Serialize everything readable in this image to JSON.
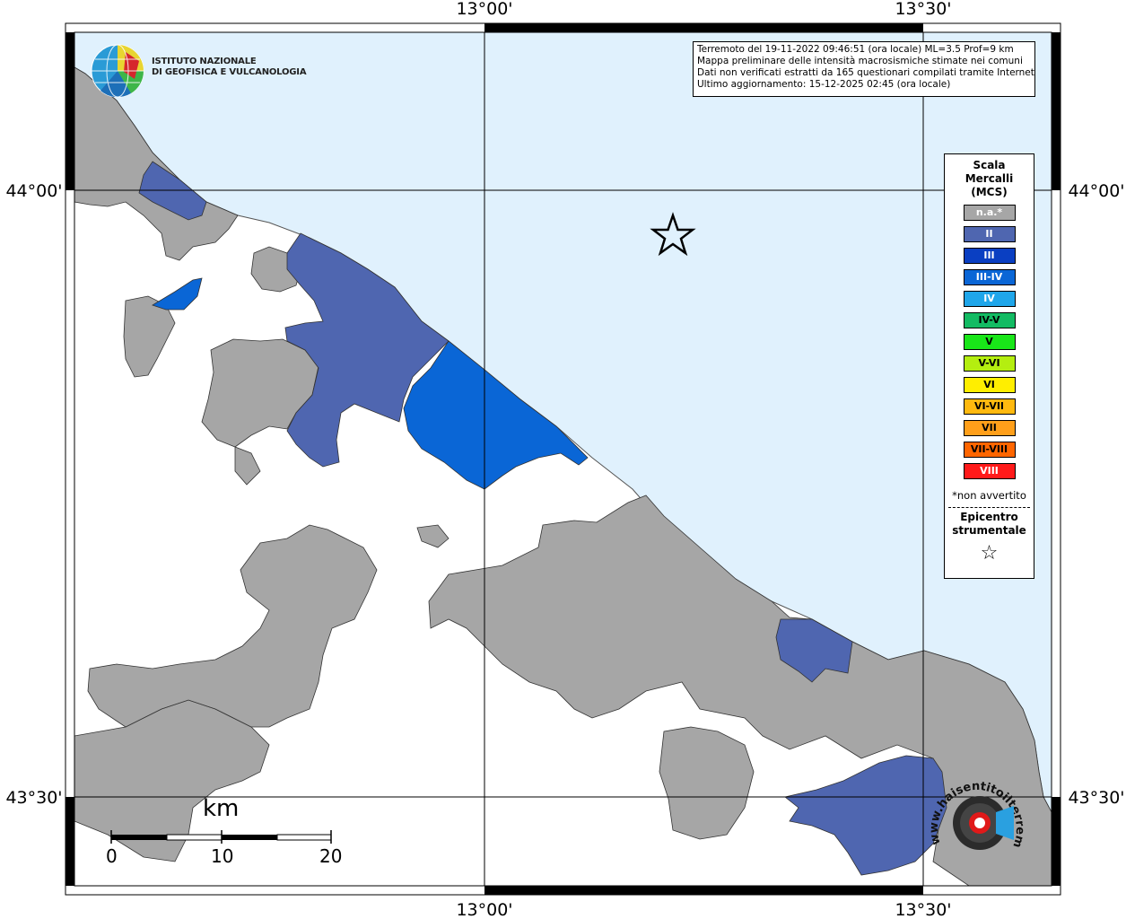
{
  "info": {
    "line1": "Terremoto del 19-11-2022 09:46:51 (ora locale) ML=3.5 Prof=9 km",
    "line2": "Mappa preliminare delle intensità macrosismiche stimate nei comuni",
    "line3": "Dati non verificati estratti da 165 questionari compilati tramite Internet.",
    "line4": "Ultimo aggiornamento: 15-12-2025 02:45 (ora locale)"
  },
  "institute": {
    "line1": "ISTITUTO NAZIONALE",
    "line2": "DI GEOFISICA E VULCANOLOGIA"
  },
  "axes": {
    "lon_top_1": "13°00'",
    "lon_top_2": "13°30'",
    "lon_bottom_1": "13°00'",
    "lon_bottom_2": "13°30'",
    "lat_left_1": "44°00'",
    "lat_left_2": "43°30'",
    "lat_right_1": "44°00'",
    "lat_right_2": "43°30'"
  },
  "legend": {
    "title_1": "Scala",
    "title_2": "Mercalli",
    "title_3": "(MCS)",
    "classes": [
      {
        "label": "n.a.*",
        "color": "#a6a6a6"
      },
      {
        "label": "II",
        "color": "#4f66b0"
      },
      {
        "label": "III",
        "color": "#0a3fc2"
      },
      {
        "label": "III-IV",
        "color": "#0a66d6"
      },
      {
        "label": "IV",
        "color": "#1fa6ea"
      },
      {
        "label": "IV-V",
        "color": "#13bb63"
      },
      {
        "label": "V",
        "color": "#19e619"
      },
      {
        "label": "V-VI",
        "color": "#b4ee10"
      },
      {
        "label": "VI",
        "color": "#ffee00"
      },
      {
        "label": "VI-VII",
        "color": "#ffb90f"
      },
      {
        "label": "VII",
        "color": "#ff9f1a"
      },
      {
        "label": "VII-VIII",
        "color": "#ff6600"
      },
      {
        "label": "VIII",
        "color": "#ff1a1a"
      }
    ],
    "note": "*non avvertito",
    "epicenter_1": "Epicentro",
    "epicenter_2": "strumentale"
  },
  "scale": {
    "unit": "km",
    "label_0": "0",
    "label_10": "10",
    "label_20": "20"
  },
  "colors": {
    "sea": "#e0f1fd",
    "land_na": "#a6a6a6",
    "int_II": "#4f66b0",
    "int_III_IV": "#0a66d6"
  },
  "watermark": {
    "text": "www.haisentitoilterremoto.it"
  }
}
